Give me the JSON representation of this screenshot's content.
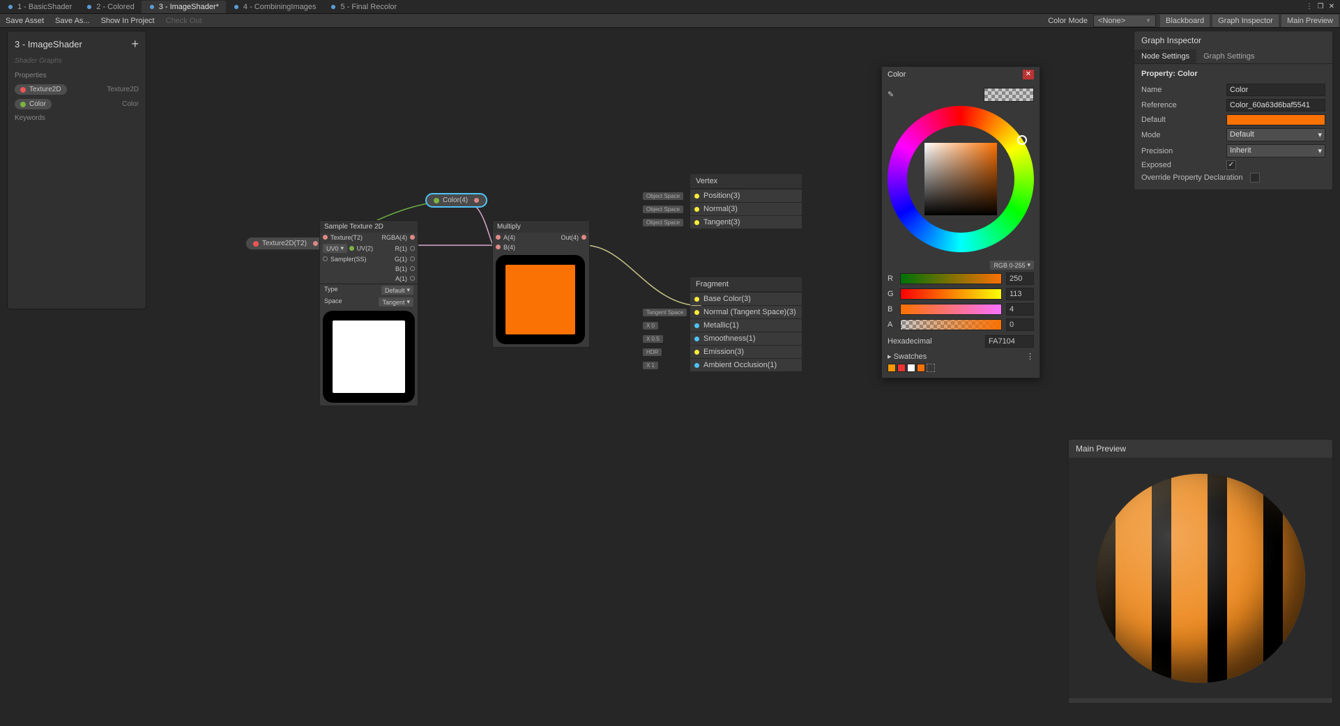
{
  "tabs": [
    {
      "label": "1 - BasicShader"
    },
    {
      "label": "2 - Colored"
    },
    {
      "label": "3 - ImageShader*"
    },
    {
      "label": "4 - CombiningImages"
    },
    {
      "label": "5 - Final Recolor"
    }
  ],
  "toolbar": {
    "save_asset": "Save Asset",
    "save_as": "Save As...",
    "show_in_project": "Show In Project",
    "check_out": "Check Out",
    "color_mode_label": "Color Mode",
    "color_mode_value": "<None>",
    "blackboard": "Blackboard",
    "graph_inspector": "Graph Inspector",
    "main_preview": "Main Preview"
  },
  "blackboard": {
    "title": "3 - ImageShader",
    "subtitle": "Shader Graphs",
    "properties_label": "Properties",
    "props": [
      {
        "name": "Texture2D",
        "type": "Texture2D"
      },
      {
        "name": "Color",
        "type": "Color"
      }
    ],
    "keywords_label": "Keywords"
  },
  "nodes": {
    "tex_prop": "Texture2D(T2)",
    "color_prop": "Color(4)",
    "sample": {
      "title": "Sample Texture 2D",
      "in": [
        "Texture(T2)",
        "UV(2)",
        "Sampler(SS)"
      ],
      "out": [
        "RGBA(4)",
        "R(1)",
        "G(1)",
        "B(1)",
        "A(1)"
      ],
      "uv_dd": "UV0",
      "type_label": "Type",
      "type_val": "Default",
      "space_label": "Space",
      "space_val": "Tangent"
    },
    "multiply": {
      "title": "Multiply",
      "in": [
        "A(4)",
        "B(4)"
      ],
      "out": "Out(4)"
    },
    "vertex": {
      "title": "Vertex",
      "rows": [
        {
          "space": "Object Space",
          "label": "Position(3)"
        },
        {
          "space": "Object Space",
          "label": "Normal(3)"
        },
        {
          "space": "Object Space",
          "label": "Tangent(3)"
        }
      ]
    },
    "fragment": {
      "title": "Fragment",
      "rows": [
        {
          "space": "",
          "label": "Base Color(3)"
        },
        {
          "space": "Tangent Space",
          "label": "Normal (Tangent Space)(3)"
        },
        {
          "space": "X  0",
          "label": "Metallic(1)"
        },
        {
          "space": "X  0.5",
          "label": "Smoothness(1)"
        },
        {
          "space": "HDR",
          "label": "Emission(3)"
        },
        {
          "space": "X  1",
          "label": "Ambient Occlusion(1)"
        }
      ]
    }
  },
  "colorwin": {
    "title": "Color",
    "mode": "RGB 0-255",
    "r": "250",
    "g": "113",
    "b": "4",
    "a": "0",
    "hex_label": "Hexadecimal",
    "hex": "FA7104",
    "swatches_label": "Swatches"
  },
  "inspector": {
    "title": "Graph Inspector",
    "tab_node": "Node Settings",
    "tab_graph": "Graph Settings",
    "header": "Property: Color",
    "name_lbl": "Name",
    "name_val": "Color",
    "ref_lbl": "Reference",
    "ref_val": "Color_60a63d6baf5541",
    "default_lbl": "Default",
    "mode_lbl": "Mode",
    "mode_val": "Default",
    "prec_lbl": "Precision",
    "prec_val": "Inherit",
    "exposed_lbl": "Exposed",
    "override_lbl": "Override Property Declaration"
  },
  "preview": {
    "title": "Main Preview"
  }
}
